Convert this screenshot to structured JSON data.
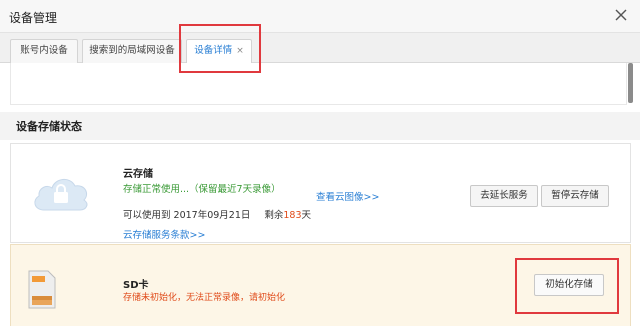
{
  "window": {
    "title": "设备管理",
    "close_icon": "close-icon"
  },
  "tabs": [
    {
      "label": "账号内设备"
    },
    {
      "label": "搜索到的局域网设备"
    },
    {
      "label": "设备详情",
      "close": "×"
    }
  ],
  "section": {
    "title": "设备存储状态"
  },
  "cloud_storage": {
    "icon": "cloud-lock-icon",
    "name": "云存储",
    "status": "存储正常使用...（保留最近7天录像）",
    "view_link": "查看云图像>>",
    "valid_until_label": "可以使用到 2017年09月21日",
    "remaining_label": "剩余",
    "remaining_days": "183",
    "remaining_unit": "天",
    "terms_link": "云存储服务条款>>",
    "extend_button": "去延长服务",
    "pause_button": "暂停云存储"
  },
  "sd_card": {
    "icon": "sd-card-icon",
    "name": "SD卡",
    "status": "存储未初始化，无法正常录像，请初始化",
    "init_button": "初始化存储"
  },
  "colors": {
    "accent": "#2a7fd4",
    "ok": "#3a9a36",
    "warn": "#e04b1a",
    "highlight": "#e0393e",
    "sd_bg": "#fdf6e7"
  }
}
